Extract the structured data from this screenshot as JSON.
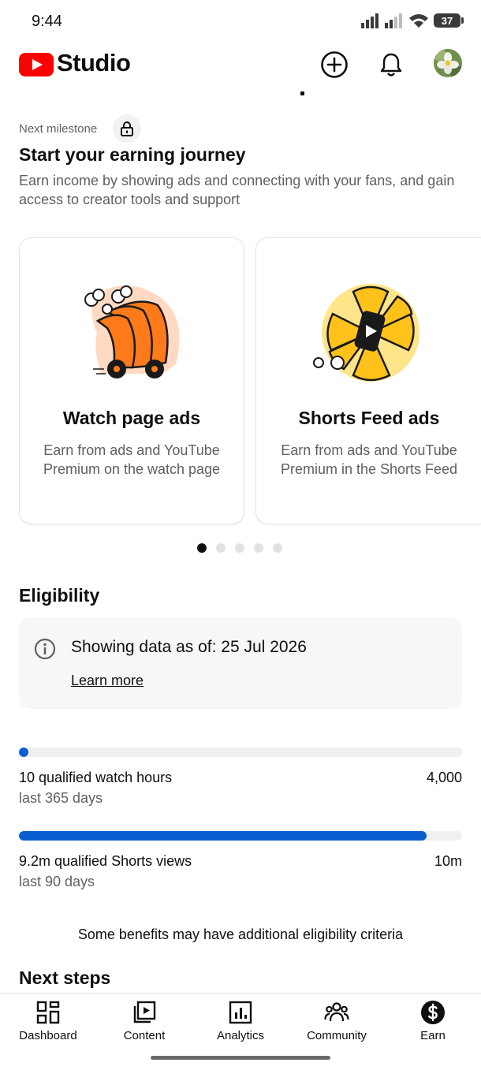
{
  "status_bar": {
    "time": "9:44",
    "battery": "37"
  },
  "header": {
    "app_name": "Studio"
  },
  "milestone": {
    "label": "Next milestone",
    "title": "Start your earning journey",
    "description": "Earn income by showing ads and connecting with your fans, and gain access to creator tools and support"
  },
  "cards": [
    {
      "title": "Watch page ads",
      "description": "Earn from ads and YouTube Premium on the watch page"
    },
    {
      "title": "Shorts Feed ads",
      "description": "Earn from ads and YouTube Premium in the Shorts Feed"
    }
  ],
  "pager": {
    "count": 5,
    "active": 0
  },
  "eligibility": {
    "title": "Eligibility",
    "info_text": "Showing data as of: 25 Jul 2026",
    "learn_more": "Learn more",
    "metrics": [
      {
        "label": "10 qualified watch hours",
        "sub": "last 365 days",
        "target": "4,000",
        "progress": 0.0025
      },
      {
        "label": "9.2m qualified Shorts views",
        "sub": "last 90 days",
        "target": "10m",
        "progress": 0.92
      }
    ],
    "note": "Some benefits may have additional eligibility criteria"
  },
  "next_steps": {
    "title": "Next steps"
  },
  "nav": [
    {
      "label": "Dashboard",
      "icon": "dashboard-icon"
    },
    {
      "label": "Content",
      "icon": "content-icon"
    },
    {
      "label": "Analytics",
      "icon": "analytics-icon"
    },
    {
      "label": "Community",
      "icon": "community-icon"
    },
    {
      "label": "Earn",
      "icon": "earn-icon"
    }
  ],
  "colors": {
    "brand_red": "#ff0000",
    "progress_blue": "#0b5ed0",
    "text_secondary": "#606060"
  }
}
